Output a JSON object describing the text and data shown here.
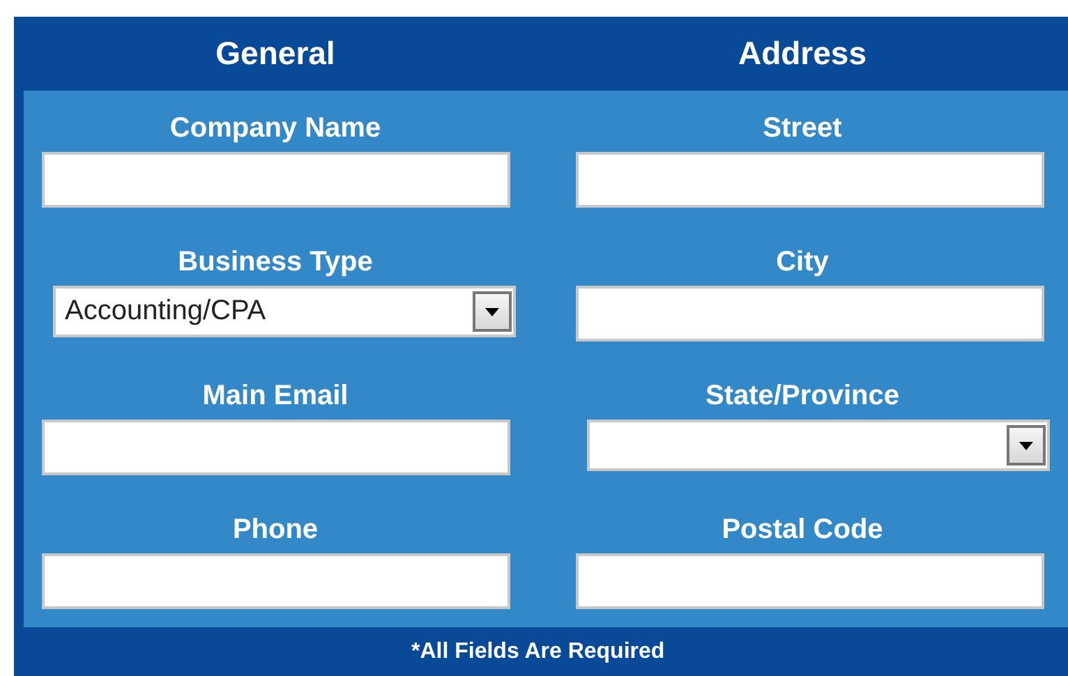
{
  "sections": [
    {
      "title": "General",
      "fields": [
        {
          "label": "Company Name",
          "kind": "text"
        },
        {
          "label": "Business Type",
          "kind": "select",
          "value": "Accounting/CPA"
        },
        {
          "label": "Main Email",
          "kind": "text"
        },
        {
          "label": "Phone",
          "kind": "text"
        }
      ]
    },
    {
      "title": "Address",
      "fields": [
        {
          "label": "Street",
          "kind": "text"
        },
        {
          "label": "City",
          "kind": "text"
        },
        {
          "label": "State/Province",
          "kind": "select"
        },
        {
          "label": "Postal Code",
          "kind": "text"
        }
      ]
    }
  ],
  "footer_note": "*All Fields Are Required"
}
